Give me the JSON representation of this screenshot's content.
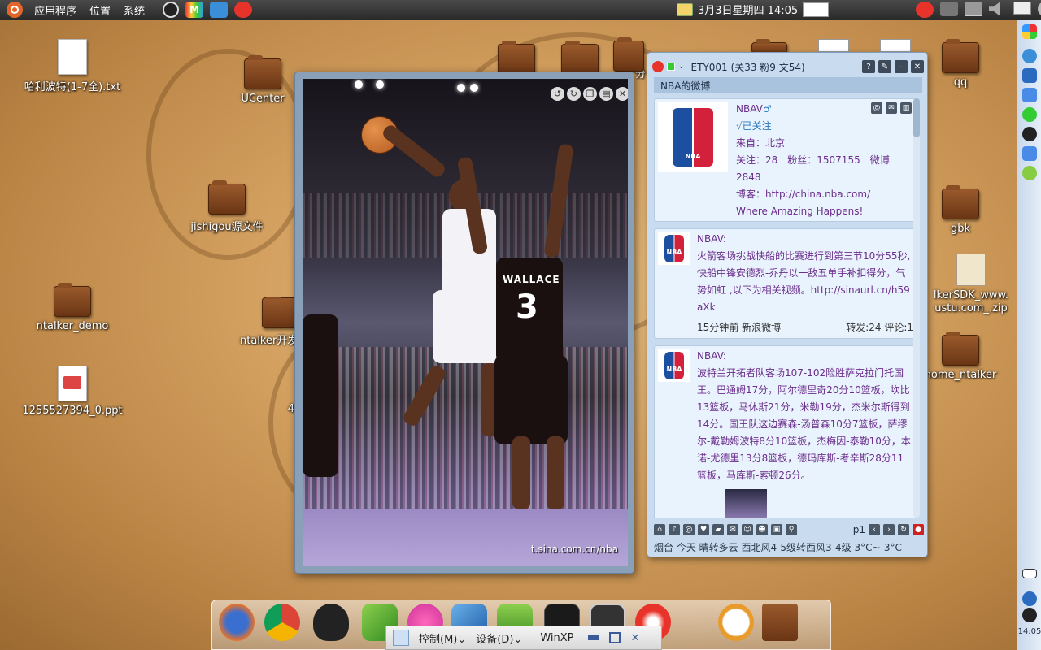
{
  "top_panel": {
    "menus": [
      "应用程序",
      "位置",
      "系统"
    ],
    "datetime": "3月3日星期四 14:05"
  },
  "desktop_icons": [
    {
      "id": "harry",
      "label": "哈利波特(1-7全).txt",
      "kind": "doc"
    },
    {
      "id": "ucenter",
      "label": "UCenter",
      "kind": "folder"
    },
    {
      "id": "jishigou",
      "label": "jishigou源文件",
      "kind": "folder"
    },
    {
      "id": "ntalker-demo",
      "label": "ntalker_demo",
      "kind": "folder"
    },
    {
      "id": "ntalker-dev",
      "label": "ntalker开发",
      "kind": "folder"
    },
    {
      "id": "ppt",
      "label": "1255527394_0.ppt",
      "kind": "ppt"
    },
    {
      "id": "qq",
      "label": "qq",
      "kind": "folder"
    },
    {
      "id": "gbk",
      "label": "gbk",
      "kind": "folder"
    },
    {
      "id": "sdk-zip",
      "label": "lkerSDK_www.\nustu.com_.zip",
      "kind": "zip"
    },
    {
      "id": "home-ntalker",
      "label": "home_ntalker",
      "kind": "folder"
    },
    {
      "id": "partial-4",
      "label": "4",
      "kind": "text"
    },
    {
      "id": "partial-fen",
      "label": "分",
      "kind": "text"
    }
  ],
  "photo_viewer": {
    "watermark": "t.sina.com.cn/nba",
    "jersey_name": "WALLACE",
    "jersey_number": "3"
  },
  "weibo": {
    "title": "ETY001 (关33 粉9 文54)",
    "subtitle": "NBA的微博",
    "profile": {
      "name": "NBA",
      "follow_status": "√已关注",
      "from": "来自：北京",
      "stats": "关注：28　粉丝：1507155　微博",
      "stats2": "2848",
      "blog": "博客：http://china.nba.com/",
      "slogan": "Where Amazing Happens!"
    },
    "posts": [
      {
        "author": "NBA",
        "body": "火箭客场挑战快船的比赛进行到第三节10分55秒, 快船中锋安德烈-乔丹以一敌五单手补扣得分，气势如虹 ,以下为相关视频。http://sinaurl.cn/h59aXk",
        "meta_time": "15分钟前 新浪微博",
        "meta_counts": "转发:24 评论:1"
      },
      {
        "author": "NBA",
        "body": "波特兰开拓者队客场107-102险胜萨克拉门托国王。巴通姆17分，阿尔德里奇20分10篮板，坎比13篮板，马休斯21分，米勒19分，杰米尔斯得到14分。国王队这边赛森-汤普森10分7篮板，萨缪尔-戴勒姆波特8分10篮板，杰梅因-泰勒10分，本诺-尤德里13分8篮板，德玛库斯-考辛斯28分11篮板，马库斯-索顿26分。"
      }
    ],
    "page_label": "p1",
    "status": "烟台 今天 晴转多云 西北风4-5级转西风3-4级 3°C~-3°C"
  },
  "vbox_bar": {
    "control_menu": "控制(M)⌄",
    "device_menu": "设备(D)⌄",
    "vm_name": "WinXP"
  },
  "side_clock": "14:05"
}
